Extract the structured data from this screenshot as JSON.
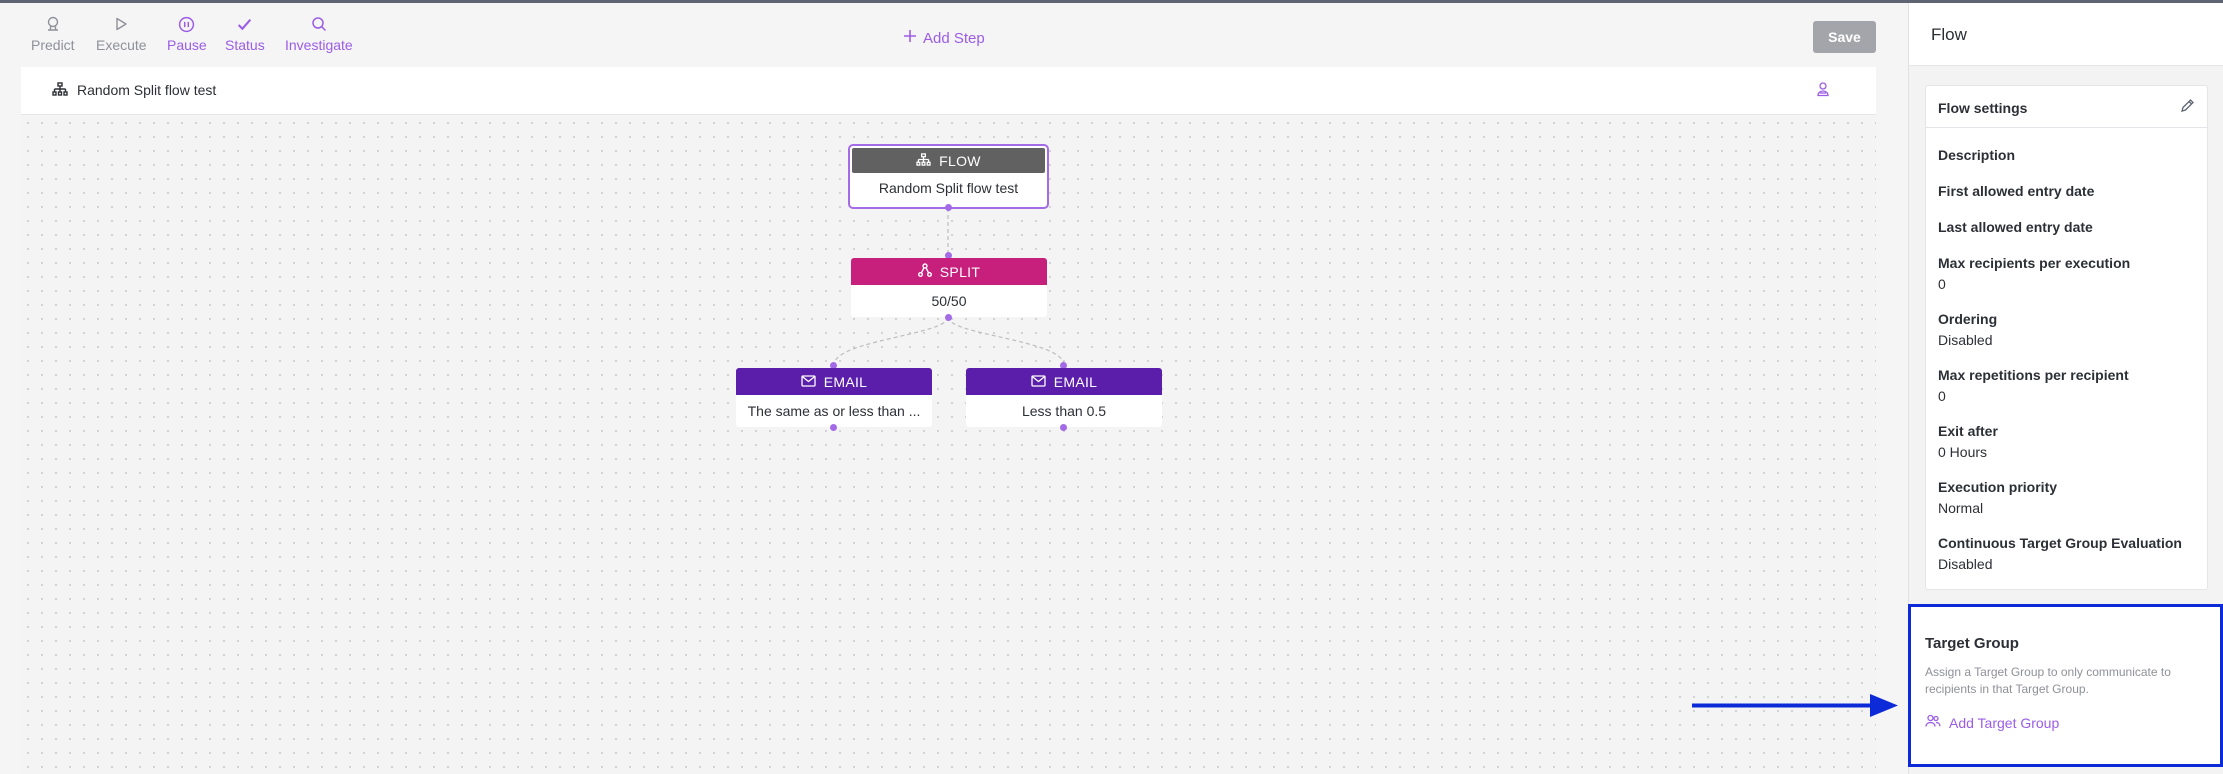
{
  "toolbar": {
    "tools": [
      {
        "label": "Predict",
        "icon": "predict-icon"
      },
      {
        "label": "Execute",
        "icon": "play-icon"
      },
      {
        "label": "Pause",
        "icon": "pause-icon"
      },
      {
        "label": "Status",
        "icon": "check-icon"
      },
      {
        "label": "Investigate",
        "icon": "search-icon"
      }
    ],
    "add_step": "Add Step",
    "save": "Save"
  },
  "canvas": {
    "title": "Random Split flow test",
    "nodes": {
      "flow": {
        "type": "FLOW",
        "text": "Random Split flow test"
      },
      "split": {
        "type": "SPLIT",
        "text": "50/50"
      },
      "email1": {
        "type": "EMAIL",
        "text": "The same as or less than ..."
      },
      "email2": {
        "type": "EMAIL",
        "text": "Less than 0.5"
      }
    }
  },
  "panel": {
    "title": "Flow",
    "settings_title": "Flow settings",
    "fields": [
      {
        "label": "Description",
        "value": ""
      },
      {
        "label": "First allowed entry date",
        "value": ""
      },
      {
        "label": "Last allowed entry date",
        "value": ""
      },
      {
        "label": "Max recipients per execution",
        "value": "0"
      },
      {
        "label": "Ordering",
        "value": "Disabled"
      },
      {
        "label": "Max repetitions per recipient",
        "value": "0"
      },
      {
        "label": "Exit after",
        "value": "0 Hours"
      },
      {
        "label": "Execution priority",
        "value": "Normal"
      },
      {
        "label": "Continuous Target Group Evaluation",
        "value": "Disabled"
      }
    ],
    "target_group": {
      "title": "Target Group",
      "description": "Assign a Target Group to only communicate to recipients in that Target Group.",
      "add_label": "Add Target Group"
    }
  },
  "colors": {
    "accent": "#9b5de5",
    "flow_header": "#616161",
    "split_header": "#c61f7c",
    "email_header": "#5b1eaa",
    "highlight": "#0c2ad8"
  }
}
